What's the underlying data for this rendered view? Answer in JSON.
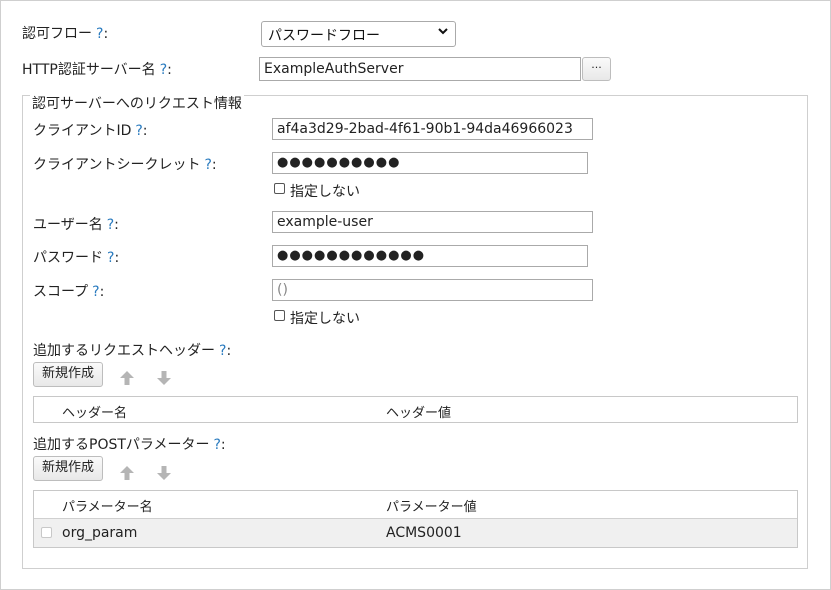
{
  "auth_flow": {
    "label": "認可フロー",
    "help": "?",
    "colon": ":",
    "value": "パスワードフロー"
  },
  "http_server": {
    "label": "HTTP認証サーバー名",
    "help": "?",
    "colon": ":",
    "value": "ExampleAuthServer",
    "browse_label": "···"
  },
  "request_group": {
    "legend": "認可サーバーへのリクエスト情報",
    "client_id": {
      "label": "クライアントID",
      "help": "?",
      "colon": ":",
      "value": "af4a3d29-2bad-4f61-90b1-94da46966023"
    },
    "client_secret": {
      "label": "クライアントシークレット",
      "help": "?",
      "colon": ":",
      "value": "●●●●●●●●●●",
      "unspecified_label": "指定しない"
    },
    "username": {
      "label": "ユーザー名",
      "help": "?",
      "colon": ":",
      "value": "example-user"
    },
    "password": {
      "label": "パスワード",
      "help": "?",
      "colon": ":",
      "value": "●●●●●●●●●●●●"
    },
    "scope": {
      "label": "スコープ",
      "help": "?",
      "colon": ":",
      "placeholder": "()",
      "unspecified_label": "指定しない"
    },
    "headers": {
      "label": "追加するリクエストヘッダー",
      "help": "?",
      "colon": ":",
      "new_label": "新規作成",
      "columns": [
        "ヘッダー名",
        "ヘッダー値"
      ]
    },
    "post_params": {
      "label": "追加するPOSTパラメーター",
      "help": "?",
      "colon": ":",
      "new_label": "新規作成",
      "columns": [
        "パラメーター名",
        "パラメーター値"
      ],
      "rows": [
        {
          "name": "org_param",
          "value": "ACMS0001"
        }
      ]
    }
  }
}
